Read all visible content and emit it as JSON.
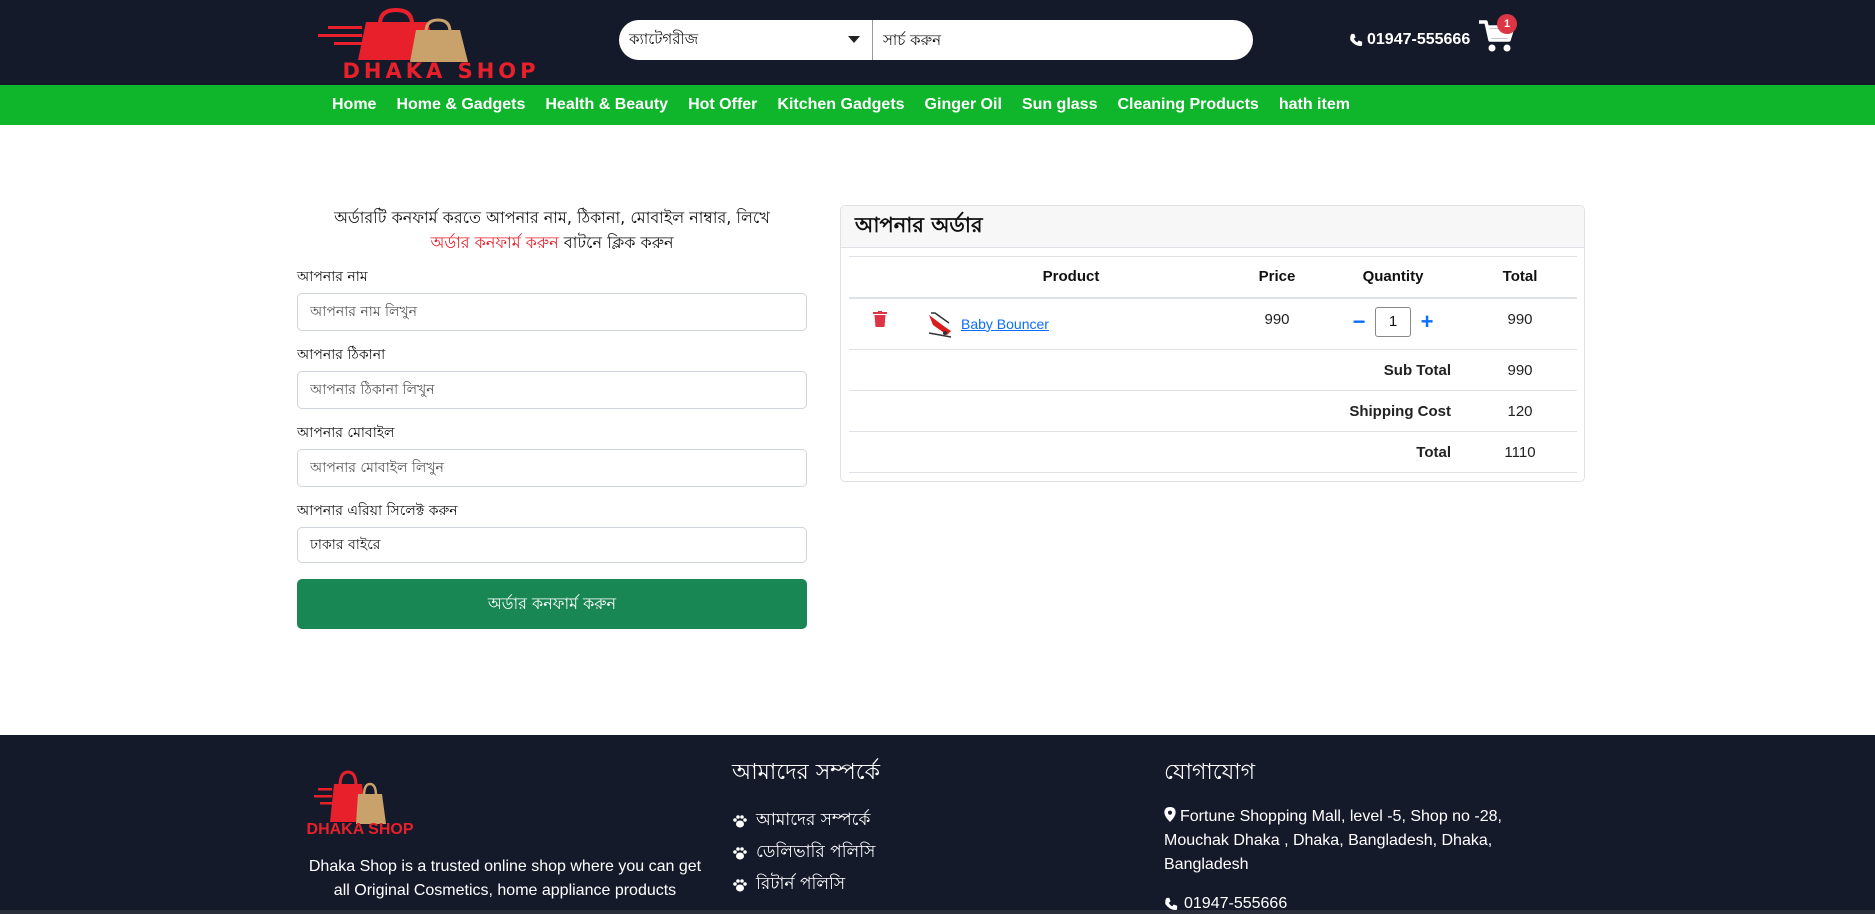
{
  "header": {
    "logo_text": "DHAKA SHOP",
    "category_select": "ক্যাটেগরীজ",
    "search_value": "সার্চ করুন",
    "phone": "01947-555666",
    "cart_count": "1"
  },
  "nav": {
    "items": [
      "Home",
      "Home & Gadgets",
      "Health & Beauty",
      "Hot Offer",
      "Kitchen Gadgets",
      "Ginger Oil",
      "Sun glass",
      "Cleaning Products",
      "hath item"
    ]
  },
  "form": {
    "intro_line1": "অর্ডারটি কনফার্ম করতে আপনার নাম, ঠিকানা, মোবাইল নাম্বার, লিখে",
    "intro_red": "অর্ডার কনফার্ম করুন",
    "intro_after": " বাটনে ক্লিক করুন",
    "name_label": "আপনার নাম",
    "name_placeholder": "আপনার নাম লিখুন",
    "address_label": "আপনার ঠিকানা",
    "address_placeholder": "আপনার ঠিকানা লিখুন",
    "mobile_label": "আপনার মোবাইল",
    "mobile_placeholder": "আপনার মোবাইল লিখুন",
    "area_label": "আপনার এরিয়া সিলেক্ট করুন",
    "area_value": "ঢাকার বাইরে",
    "confirm_button": "অর্ডার কনফার্ম করুন"
  },
  "order": {
    "title": "আপনার অর্ডার",
    "columns": {
      "product": "Product",
      "price": "Price",
      "quantity": "Quantity",
      "total": "Total"
    },
    "item": {
      "name": "Baby Bouncer",
      "price": "990",
      "quantity": "1",
      "total": "990"
    },
    "summary": {
      "subtotal_label": "Sub Total",
      "subtotal": "990",
      "shipping_label": "Shipping Cost",
      "shipping": "120",
      "total_label": "Total",
      "total": "1110"
    }
  },
  "footer": {
    "logo_text": "DHAKA SHOP",
    "about_text": "Dhaka Shop is a trusted online shop where you can get all Original Cosmetics, home appliance products",
    "about_title": "আমাদের সম্পর্কে",
    "links": [
      "আমাদের সম্পর্কে",
      "ডেলিভারি পলিসি",
      "রিটার্ন পলিসি"
    ],
    "contact_title": "যোগাযোগ",
    "address": "Fortune Shopping Mall, level -5, Shop no -28, Mouchak Dhaka , Dhaka, Bangladesh, Dhaka, Bangladesh",
    "phone": "01947-555666"
  },
  "colors": {
    "header_bg": "#151a2b",
    "nav_bg": "#0fb52a",
    "confirm_button": "#198754",
    "accent_red": "#e8202b",
    "link_blue": "#0d6efd"
  }
}
